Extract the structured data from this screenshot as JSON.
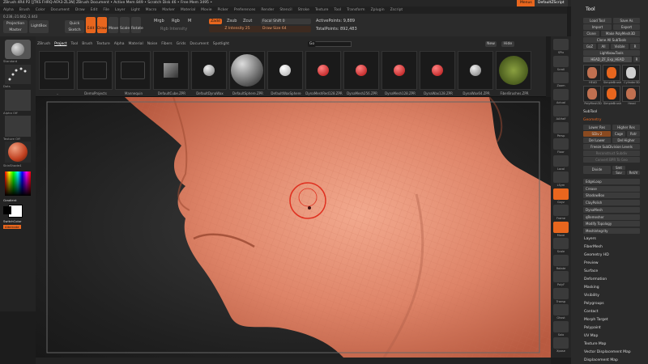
{
  "window": {
    "title": "ZBrush 4R4 P2 [JTKS FHRQ-AFA3-ZL3N]   ZBrush Document   • Active Mem 849 • Scratch Disk 46 • Free Mem 3495 •",
    "menu_btn": "Menus",
    "script_btn": "DefaultZScript"
  },
  "menubar": [
    "Alpha",
    "Brush",
    "Color",
    "Document",
    "Draw",
    "Edit",
    "File",
    "Layer",
    "Light",
    "Macro",
    "Marker",
    "Material",
    "Movie",
    "Picker",
    "Preferences",
    "Render",
    "Stencil",
    "Stroke",
    "Texture",
    "Tool",
    "Transform",
    "Zplugin",
    "Zscript"
  ],
  "coords": "0.238,-21.662,-2.443",
  "toolbar": {
    "projection_master": "Projection Master",
    "lightbox": "LightBox",
    "quick_sketch": "Quick Sketch",
    "edit": "Edit",
    "draw": "Draw",
    "move": "Move",
    "scale": "Scale",
    "rotate": "Rotate",
    "mrgb": "Mrgb",
    "rgb": "Rgb",
    "m": "M",
    "rgb_intensity": "Rgb Intensity",
    "zadd": "Zadd",
    "zsub": "Zsub",
    "zcut": "Zcut",
    "z_intensity": "Z Intensity 25",
    "focal_shift": "Focal Shift 0",
    "draw_size": "Draw Size 64",
    "active_points": "ActivePoints: 9,889",
    "total_points": "TotalPoints: 892,483"
  },
  "lightbox": {
    "tabs": [
      "ZBrush",
      "Project",
      "Tool",
      "Brush",
      "Texture",
      "Alpha",
      "Material",
      "Noise",
      "Fibers",
      "Grids",
      "Document",
      "Spotlight"
    ],
    "active_tab": "Project",
    "go": "Go",
    "new": "New",
    "hide": "Hide",
    "items": [
      "..",
      "DemoProjects",
      "Mannequin",
      "DefaultCube.ZPR",
      "DefaultDynaWax",
      "DefaultSphere.ZPR",
      "DefaultWaxSphere",
      "DynaMeshRed128.ZPR",
      "DynaMesh256.ZPR",
      "DynaMesh128.ZPR",
      "DynaWax128.ZPR",
      "DynaWax64.ZPR",
      "FiberBrushes.ZPR"
    ]
  },
  "left_shelf": {
    "standard": "Standard",
    "dots": "Dots",
    "alpha_off": "Alpha Off",
    "texture_off": "Texture Off",
    "material": "SkinShade4",
    "gradient": "Gradient",
    "switch_color": "SwitchColor",
    "alternate": "Alternate"
  },
  "right_shelf": [
    "SPix",
    "Scroll",
    "Zoom",
    "Actual",
    "AAHalf",
    "Persp",
    "Floor",
    "Local",
    "LSym",
    "Gxyz",
    "Frame",
    "Move",
    "Scale",
    "Rotate",
    "PolyF",
    "Transp",
    "Ghost",
    "Solo",
    "Xpose"
  ],
  "tool_panel": {
    "header": "Tool",
    "load_tool": "Load Tool",
    "save_as": "Save As",
    "import": "Import",
    "export": "Export",
    "clone": "Clone",
    "make_polymesh": "Make PolyMesh3D",
    "clone_all": "Clone All SubTools",
    "goz": "GoZ",
    "all": "All",
    "visible": "Visible",
    "r": "R",
    "lightbox_tools": "Lightbox▸Tools",
    "current_tool": "HEAD_ZF_Exp_HEAD",
    "thumbs": [
      "HEAD",
      "SimpleBrush",
      "Cylinder3D",
      "PolyMesh3D",
      "SimpleBrush",
      "Head"
    ],
    "subtool": "SubTool",
    "geometry": "Geometry",
    "lower_res": "Lower Res",
    "higher_res": "Higher Res",
    "sdiv": "SDiv 2",
    "cage": "Cage",
    "rstr": "Rstr",
    "del_lower": "Del Lower",
    "del_higher": "Del Higher",
    "freeze": "Freeze SubDivision Levels",
    "reconstruct": "Reconstruct Subdiv",
    "convert": "Convert BPR To Geo",
    "divide": "Divide",
    "smt": "Smt",
    "suv": "Suv",
    "reuv": "ReUV",
    "list": [
      "EdgeLoop",
      "Crease",
      "ShadowBox",
      "ClayPolish",
      "DynaMesh",
      "qRemesher",
      "Modify Topology",
      "MeshIntegrity"
    ],
    "sections": [
      "Layers",
      "FiberMesh",
      "Geometry HD",
      "Preview",
      "Surface",
      "Deformation",
      "Masking",
      "Visibility",
      "Polygroups",
      "Contact",
      "Morph Target",
      "Polypaint",
      "UV Map",
      "Texture Map",
      "Vector Displacement Map",
      "Displacement Map"
    ]
  },
  "colors": {
    "accent": "#e8661e",
    "bg": "#1c1c1c",
    "skin": "#d97a5e"
  }
}
